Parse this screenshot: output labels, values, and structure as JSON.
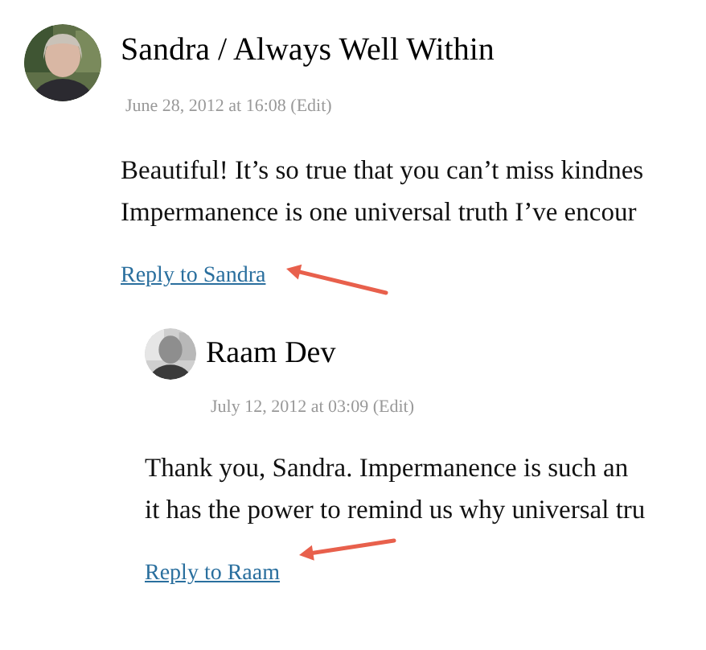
{
  "comments": [
    {
      "author": "Sandra / Always Well Within",
      "date": "June 28, 2012 at 16:08 (Edit)",
      "lines": [
        "Beautiful! It’s so true that you can’t miss kindnes",
        "Impermanence is one universal truth I’ve encour"
      ],
      "reply": "Reply to Sandra",
      "avatar": {
        "kind": "picture"
      },
      "children": [
        {
          "author": "Raam Dev",
          "date": "July 12, 2012 at 03:09 (Edit)",
          "lines": [
            "Thank you, Sandra. Impermanence is such an",
            "it has the power to remind us why universal tru"
          ],
          "reply": "Reply to Raam",
          "avatar": {
            "kind": "picture"
          }
        }
      ]
    }
  ]
}
